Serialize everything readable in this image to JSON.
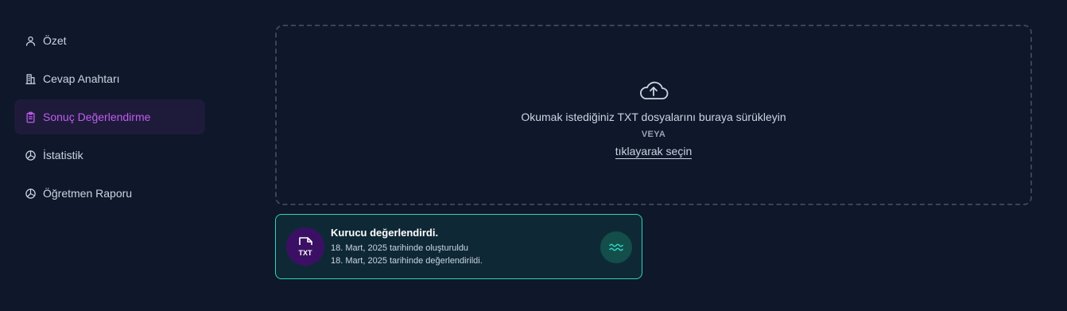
{
  "sidebar": {
    "items": [
      {
        "label": "Özet",
        "icon": "user-icon",
        "active": false
      },
      {
        "label": "Cevap Anahtarı",
        "icon": "building-icon",
        "active": false
      },
      {
        "label": "Sonuç Değerlendirme",
        "icon": "clipboard-icon",
        "active": true
      },
      {
        "label": "İstatistik",
        "icon": "pie-chart-icon",
        "active": false
      },
      {
        "label": "Öğretmen Raporu",
        "icon": "pie-chart-icon",
        "active": false
      }
    ]
  },
  "dropzone": {
    "icon": "cloud-upload-icon",
    "main_text": "Okumak istediğiniz TXT dosyalarını buraya sürükleyin",
    "or_text": "VEYA",
    "select_link": "tıklayarak seçin"
  },
  "file_card": {
    "file_type": "TXT",
    "title": "Kurucu değerlendirdi.",
    "created": "18. Mart, 2025 tarihinde oluşturuldu",
    "evaluated": "18. Mart, 2025 tarihinde değerlendirildi.",
    "action_icon": "wave-icon"
  },
  "colors": {
    "background": "#0f172a",
    "active_accent": "#c05cf0",
    "card_border": "#2dd4bf",
    "file_avatar": "#3b1064"
  }
}
